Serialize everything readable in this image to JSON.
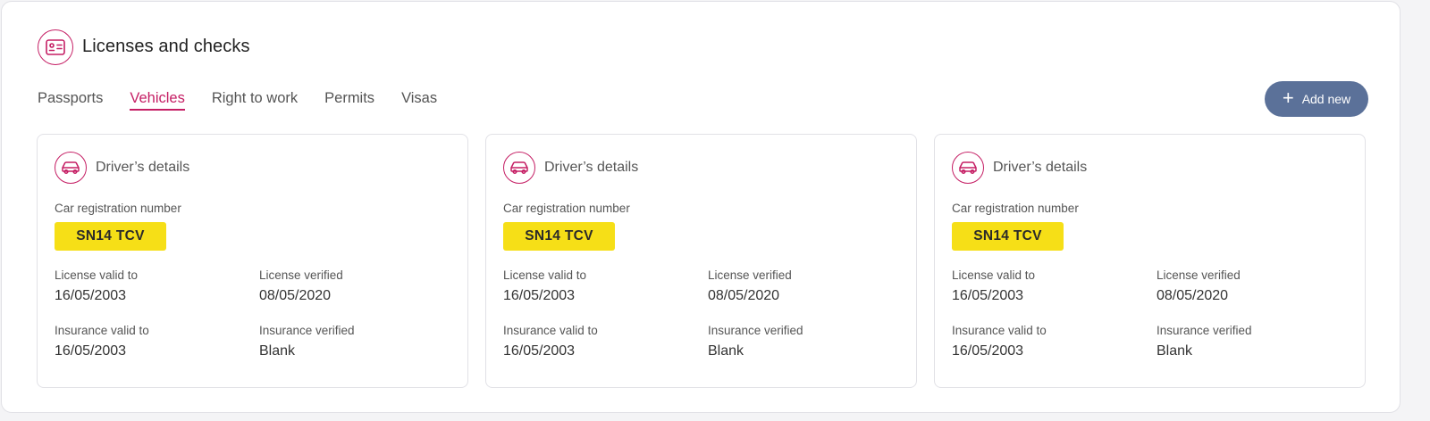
{
  "header": {
    "title": "Licenses and checks",
    "icon": "id-card-icon"
  },
  "tabs": [
    {
      "label": "Passports",
      "active": false
    },
    {
      "label": "Vehicles",
      "active": true
    },
    {
      "label": "Right to work",
      "active": false
    },
    {
      "label": "Permits",
      "active": false
    },
    {
      "label": "Visas",
      "active": false
    }
  ],
  "add_button": {
    "label": "Add new",
    "icon": "plus-icon"
  },
  "colors": {
    "accent": "#c51e64",
    "button": "#5b7199",
    "plate": "#f6df17"
  },
  "cards": [
    {
      "title": "Driver’s details",
      "icon": "car-icon",
      "reg_label": "Car registration number",
      "reg_number": "SN14 TCV",
      "license_valid_label": "License valid to",
      "license_valid_value": "16/05/2003",
      "license_verified_label": "License verified",
      "license_verified_value": "08/05/2020",
      "insurance_valid_label": "Insurance valid to",
      "insurance_valid_value": "16/05/2003",
      "insurance_verified_label": "Insurance verified",
      "insurance_verified_value": "Blank"
    },
    {
      "title": "Driver’s details",
      "icon": "car-icon",
      "reg_label": "Car registration number",
      "reg_number": "SN14 TCV",
      "license_valid_label": "License valid to",
      "license_valid_value": "16/05/2003",
      "license_verified_label": "License verified",
      "license_verified_value": "08/05/2020",
      "insurance_valid_label": "Insurance valid to",
      "insurance_valid_value": "16/05/2003",
      "insurance_verified_label": "Insurance verified",
      "insurance_verified_value": "Blank"
    },
    {
      "title": "Driver’s details",
      "icon": "car-icon",
      "reg_label": "Car registration number",
      "reg_number": "SN14 TCV",
      "license_valid_label": "License valid to",
      "license_valid_value": "16/05/2003",
      "license_verified_label": "License verified",
      "license_verified_value": "08/05/2020",
      "insurance_valid_label": "Insurance valid to",
      "insurance_valid_value": "16/05/2003",
      "insurance_verified_label": "Insurance verified",
      "insurance_verified_value": "Blank"
    }
  ]
}
